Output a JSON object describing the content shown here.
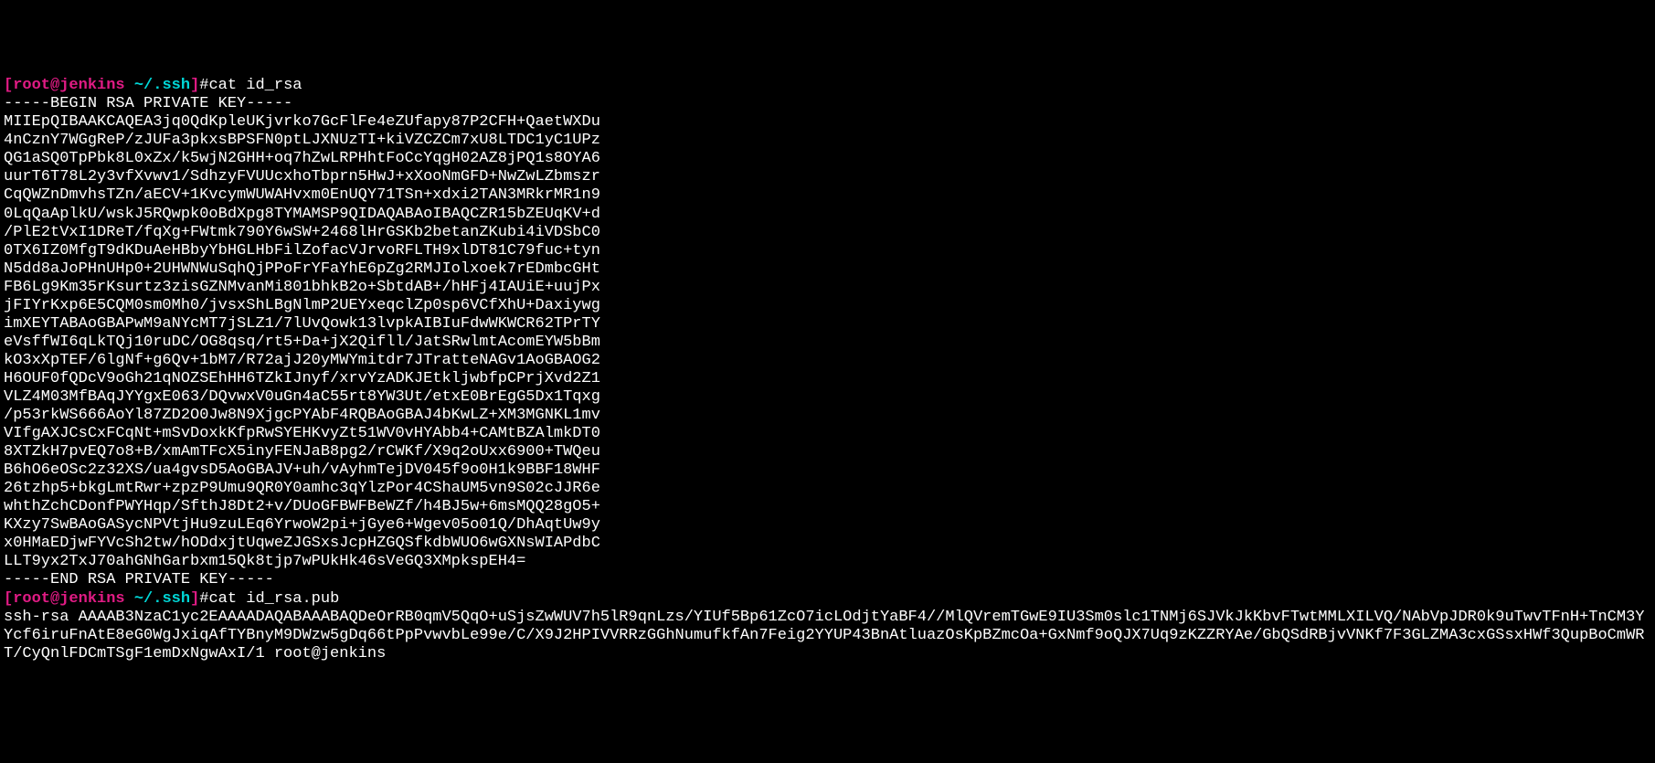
{
  "prompt1": {
    "open": "[",
    "user": "root",
    "at": "@",
    "host": "jenkins",
    "path": " ~/.ssh",
    "close": "]",
    "hash": "#",
    "command": "cat id_rsa"
  },
  "output1": [
    "-----BEGIN RSA PRIVATE KEY-----",
    "MIIEpQIBAAKCAQEA3jq0QdKpleUKjvrko7GcFlFe4eZUfapy87P2CFH+QaetWXDu",
    "4nCznY7WGgReP/zJUFa3pkxsBPSFN0ptLJXNUzTI+kiVZCZCm7xU8LTDC1yC1UPz",
    "QG1aSQ0TpPbk8L0xZx/k5wjN2GHH+oq7hZwLRPHhtFoCcYqgH02AZ8jPQ1s8OYA6",
    "uurT6T78L2y3vfXvwv1/SdhzyFVUUcxhoTbprn5HwJ+xXooNmGFD+NwZwLZbmszr",
    "CqQWZnDmvhsTZn/aECV+1KvcymWUWAHvxm0EnUQY71TSn+xdxi2TAN3MRkrMR1n9",
    "0LqQaAplkU/wskJ5RQwpk0oBdXpg8TYMAMSP9QIDAQABAoIBAQCZR15bZEUqKV+d",
    "/PlE2tVxI1DReT/fqXg+FWtmk790Y6wSW+2468lHrGSKb2betanZKubi4iVDSbC0",
    "0TX6IZ0MfgT9dKDuAeHBbyYbHGLHbFilZofacVJrvoRFLTH9xlDT81C79fuc+tyn",
    "N5dd8aJoPHnUHp0+2UHWNWuSqhQjPPoFrYFaYhE6pZg2RMJIolxoek7rEDmbcGHt",
    "FB6Lg9Km35rKsurtz3zisGZNMvanMi801bhkB2o+SbtdAB+/hHFj4IAUiE+uujPx",
    "jFIYrKxp6E5CQM0sm0Mh0/jvsxShLBgNlmP2UEYxeqclZp0sp6VCfXhU+Daxiywg",
    "imXEYTABAoGBAPwM9aNYcMT7jSLZ1/7lUvQowk13lvpkAIBIuFdwWKWCR62TPrTY",
    "eVsffWI6qLkTQj10ruDC/OG8qsq/rt5+Da+jX2Qifll/JatSRwlmtAcomEYW5bBm",
    "kO3xXpTEF/6lgNf+g6Qv+1bM7/R72ajJ20yMWYmitdr7JTratteNAGv1AoGBAOG2",
    "H6OUF0fQDcV9oGh21qNOZSEhHH6TZkIJnyf/xrvYzADKJEtkljwbfpCPrjXvd2Z1",
    "VLZ4M03MfBAqJYYgxE063/DQvwxV0uGn4aC55rt8YW3Ut/etxE0BrEgG5Dx1Tqxg",
    "/p53rkWS666AoYl87ZD2O0Jw8N9XjgcPYAbF4RQBAoGBAJ4bKwLZ+XM3MGNKL1mv",
    "VIfgAXJCsCxFCqNt+mSvDoxkKfpRwSYEHKvyZt51WV0vHYAbb4+CAMtBZAlmkDT0",
    "8XTZkH7pvEQ7o8+B/xmAmTFcX5inyFENJaB8pg2/rCWKf/X9q2oUxx6900+TWQeu",
    "B6hO6eOSc2z32XS/ua4gvsD5AoGBAJV+uh/vAyhmTejDV045f9o0H1k9BBF18WHF",
    "26tzhp5+bkgLmtRwr+zpzP9Umu9QR0Y0amhc3qYlzPor4CShaUM5vn9S02cJJR6e",
    "whthZchCDonfPWYHqp/SfthJ8Dt2+v/DUoGFBWFBeWZf/h4BJ5w+6msMQQ28gO5+",
    "KXzy7SwBAoGASycNPVtjHu9zuLEq6YrwoW2pi+jGye6+Wgev05o01Q/DhAqtUw9y",
    "x0HMaEDjwFYVcSh2tw/hODdxjtUqweZJGSxsJcpHZGQSfkdbWUO6wGXNsWIAPdbC",
    "LLT9yx2TxJ70ahGNhGarbxm15Qk8tjp7wPUkHk46sVeGQ3XMpkspEH4=",
    "-----END RSA PRIVATE KEY-----"
  ],
  "prompt2": {
    "open": "[",
    "user": "root",
    "at": "@",
    "host": "jenkins",
    "path": " ~/.ssh",
    "close": "]",
    "hash": "#",
    "command": "cat id_rsa.pub"
  },
  "output2": "ssh-rsa AAAAB3NzaC1yc2EAAAADAQABAAABAQDeOrRB0qmV5QqO+uSjsZwWUV7h5lR9qnLzs/YIUf5Bp61ZcO7icLOdjtYaBF4//MlQVremTGwE9IU3Sm0slc1TNMj6SJVkJkKbvFTwtMMLXILVQ/NAbVpJDR0k9uTwvTFnH+TnCM3YYcf6iruFnAtE8eG0WgJxiqAfTYBnyM9DWzw5gDq66tPpPvwvbLe99e/C/X9J2HPIVVRRzGGhNumufkfAn7Feig2YYUP43BnAtluazOsKpBZmcOa+GxNmf9oQJX7Uq9zKZZRYAe/GbQSdRBjvVNKf7F3GLZMA3cxGSsxHWf3QupBoCmWRT/CyQnlFDCmTSgF1emDxNgwAxI/1 root@jenkins"
}
